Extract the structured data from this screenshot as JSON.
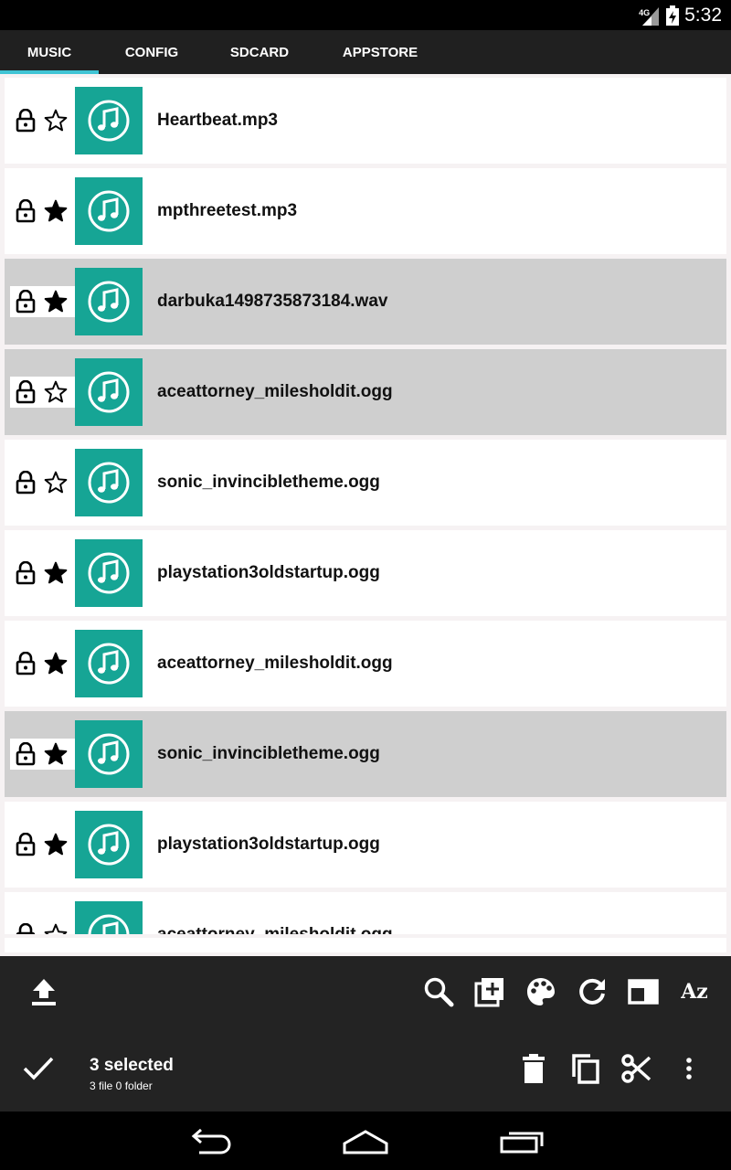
{
  "status_bar": {
    "network": "4G",
    "time": "5:32"
  },
  "tabs": [
    {
      "label": "MUSIC",
      "active": true
    },
    {
      "label": "CONFIG",
      "active": false
    },
    {
      "label": "SDCARD",
      "active": false
    },
    {
      "label": "APPSTORE",
      "active": false
    }
  ],
  "files": [
    {
      "name": "Heartbeat.mp3",
      "starred": false,
      "selected": false
    },
    {
      "name": "mpthreetest.mp3",
      "starred": true,
      "selected": false
    },
    {
      "name": "darbuka1498735873184.wav",
      "starred": true,
      "selected": true
    },
    {
      "name": "aceattorney_milesholdit.ogg",
      "starred": false,
      "selected": true
    },
    {
      "name": "sonic_invinciblethemе.ogg",
      "starred": false,
      "selected": false
    },
    {
      "name": "playstation3oldstartup.ogg",
      "starred": true,
      "selected": false
    },
    {
      "name": "aceattorney_milesholdit.ogg",
      "starred": true,
      "selected": false
    },
    {
      "name": "sonic_invincibletheme.ogg",
      "starred": true,
      "selected": true
    },
    {
      "name": "playstation3oldstartup.ogg",
      "starred": true,
      "selected": false
    },
    {
      "name": "aceattorney_milesholdit.ogg",
      "starred": false,
      "selected": false
    }
  ],
  "toolbar": {
    "left_icon": "upload-icon",
    "right_icons": [
      "search-icon",
      "add-library-icon",
      "palette-icon",
      "refresh-icon",
      "view-mode-icon",
      "sort-az-icon"
    ],
    "sort_label": "Az"
  },
  "selection": {
    "title": "3 selected",
    "subtitle": "3 file 0 folder",
    "icons": [
      "check-icon",
      "delete-icon",
      "copy-icon",
      "cut-icon",
      "more-icon"
    ]
  },
  "colors": {
    "accent": "#40c4d4",
    "thumb": "#16a595",
    "selected_row": "#cfcfcf",
    "bar": "#232323"
  }
}
